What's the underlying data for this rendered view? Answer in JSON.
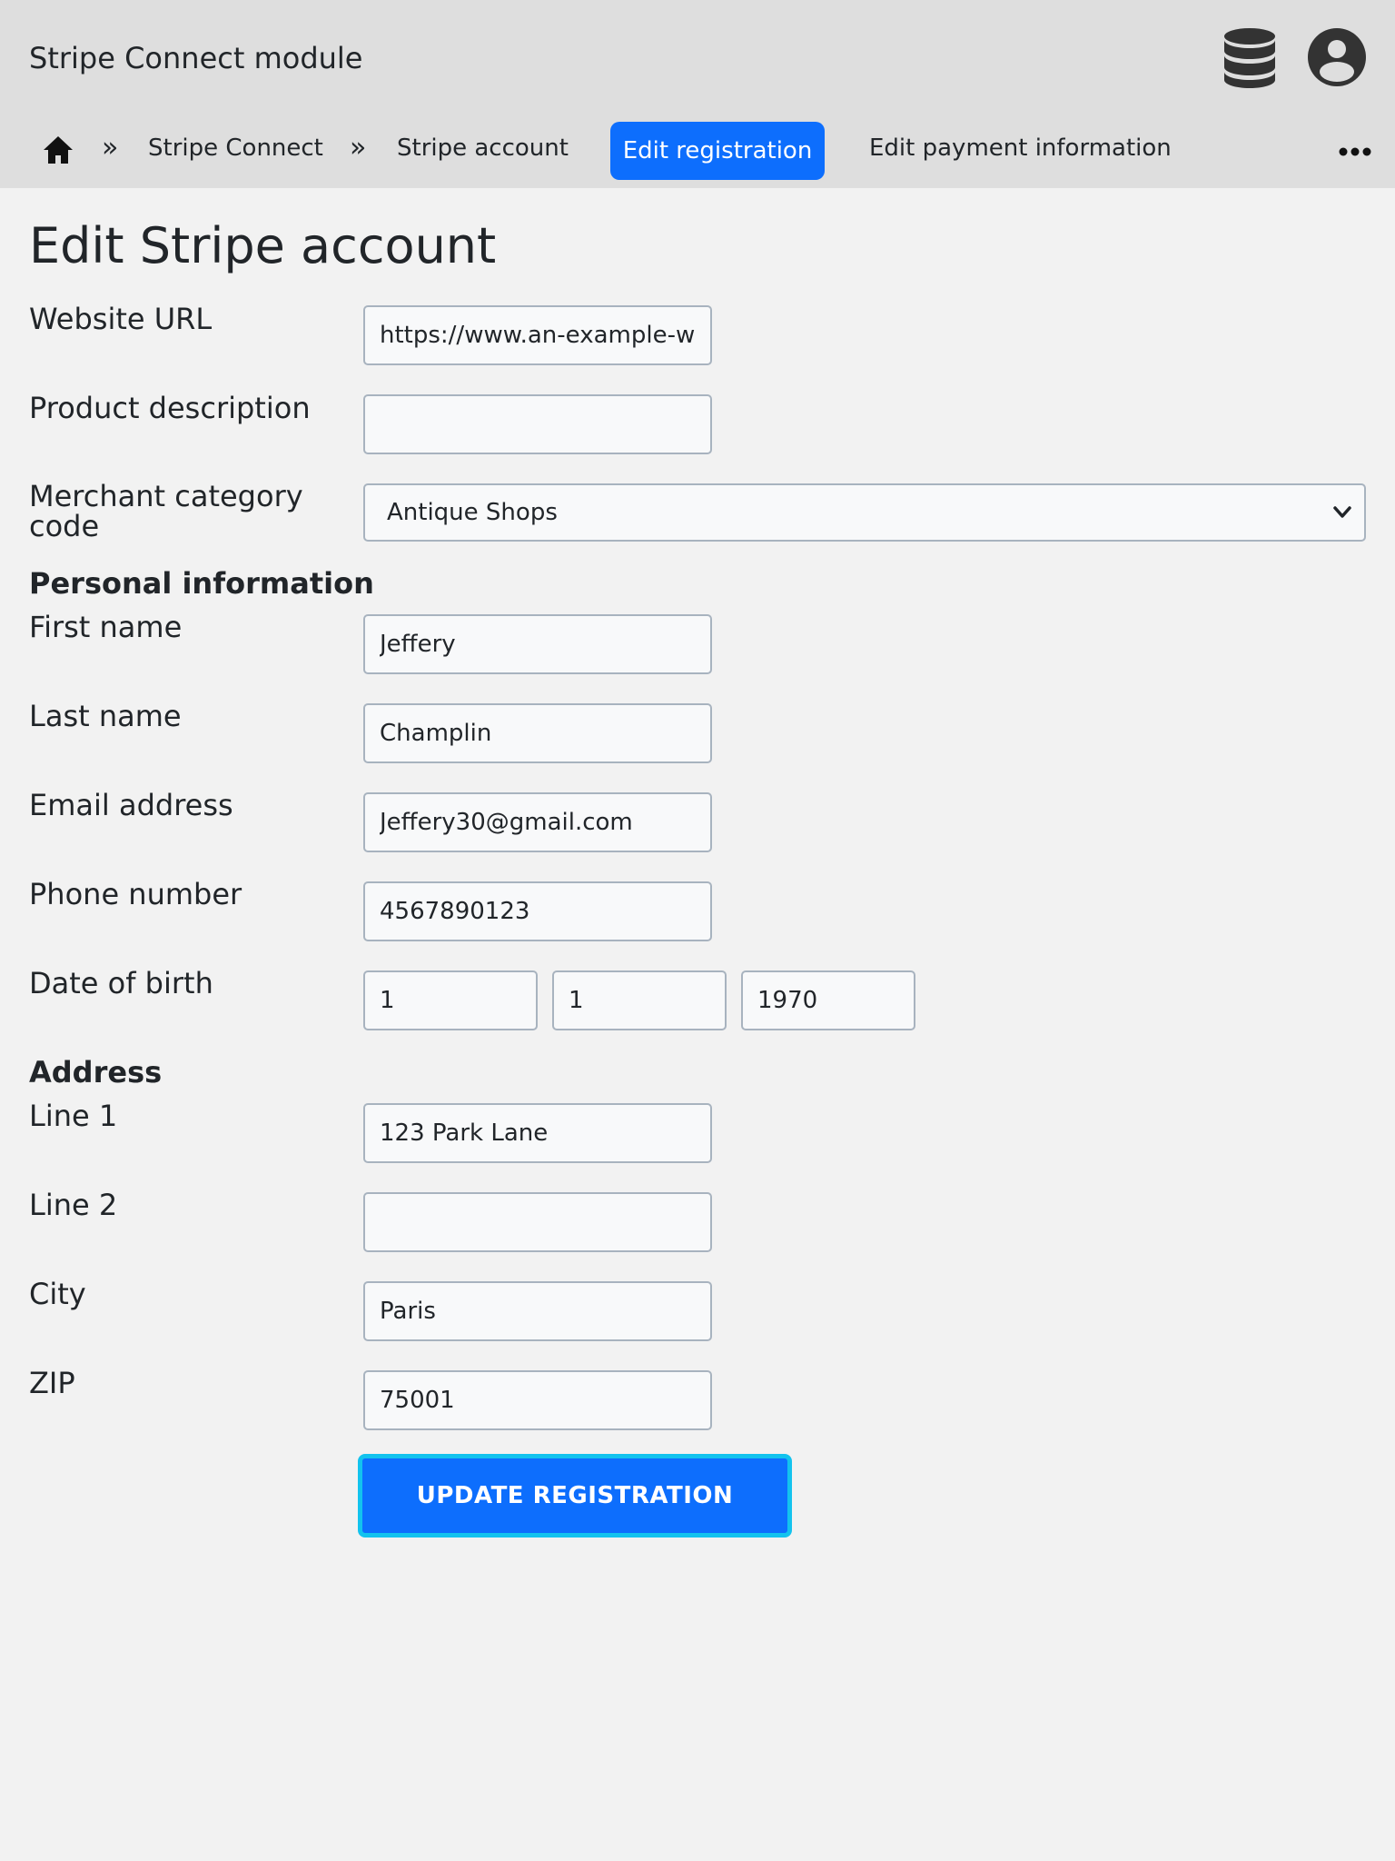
{
  "app": {
    "title": "Stripe Connect module",
    "header_icons": [
      "database-icon",
      "user-circle-icon"
    ]
  },
  "breadcrumb": {
    "home_icon": "home-icon",
    "separator": "»",
    "items": [
      "Stripe Connect",
      "Stripe account"
    ],
    "tabs": [
      {
        "label": "Edit registration",
        "active": true
      },
      {
        "label": "Edit payment information",
        "active": false
      }
    ],
    "more_icon": "more-horizontal-icon"
  },
  "page": {
    "title": "Edit Stripe account"
  },
  "form": {
    "website_url": {
      "label": "Website URL",
      "value": "https://www.an-example-w"
    },
    "product_description": {
      "label": "Product description",
      "value": ""
    },
    "merchant_category": {
      "label": "Merchant category code",
      "value": "Antique Shops"
    },
    "personal_section": "Personal information",
    "first_name": {
      "label": "First name",
      "value": "Jeffery"
    },
    "last_name": {
      "label": "Last name",
      "value": "Champlin"
    },
    "email": {
      "label": "Email address",
      "value": "Jeffery30@gmail.com"
    },
    "phone": {
      "label": "Phone number",
      "value": "4567890123"
    },
    "dob": {
      "label": "Date of birth",
      "day": "1",
      "month": "1",
      "year": "1970"
    },
    "address_section": "Address",
    "line1": {
      "label": "Line 1",
      "value": "123 Park Lane"
    },
    "line2": {
      "label": "Line 2",
      "value": ""
    },
    "city": {
      "label": "City",
      "value": "Paris"
    },
    "zip": {
      "label": "ZIP",
      "value": "75001"
    },
    "submit_label": "UPDATE REGISTRATION"
  },
  "colors": {
    "primary": "#0d6efd",
    "focus_ring": "#13c3ee",
    "header_bg": "#dedede",
    "page_bg": "#f2f2f2"
  }
}
